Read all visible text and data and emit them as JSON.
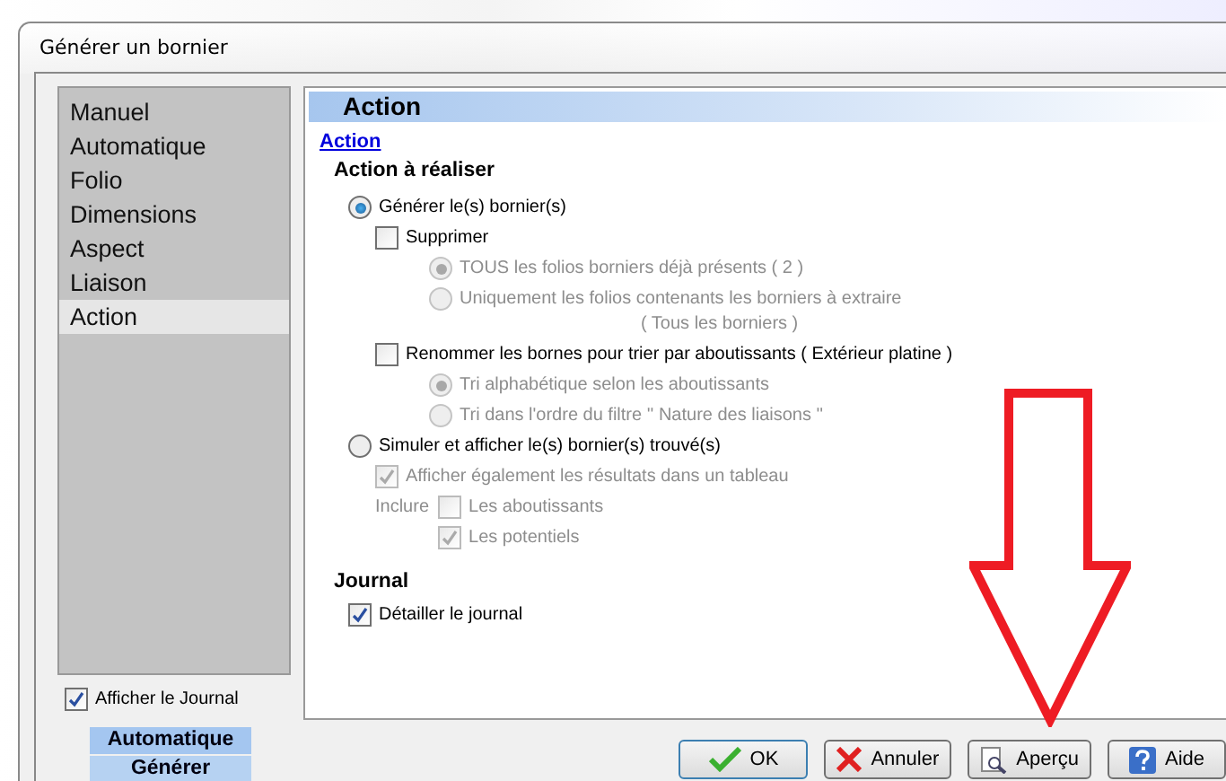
{
  "window": {
    "title": "Générer un bornier"
  },
  "sidebar": {
    "items": [
      {
        "label": "Manuel",
        "selected": false
      },
      {
        "label": "Automatique",
        "selected": false
      },
      {
        "label": "Folio",
        "selected": false
      },
      {
        "label": "Dimensions",
        "selected": false
      },
      {
        "label": "Aspect",
        "selected": false
      },
      {
        "label": "Liaison",
        "selected": false
      },
      {
        "label": "Action",
        "selected": true
      }
    ],
    "show_log": {
      "label": "Afficher le Journal",
      "checked": true
    }
  },
  "panel": {
    "header": "Action",
    "link": "Action",
    "section_title": "Action à réaliser",
    "options": [
      {
        "kind": "radio",
        "label": "Générer le(s) bornier(s)",
        "selected": true,
        "disabled": false,
        "children": [
          {
            "kind": "checkbox",
            "label": "Supprimer",
            "checked": false,
            "disabled": false,
            "children": [
              {
                "kind": "radio",
                "label": "TOUS les folios borniers déjà présents ( 2 )",
                "selected": true,
                "disabled": true
              },
              {
                "kind": "radio",
                "label": "Uniquement les folios contenants les borniers à extraire",
                "note": "( Tous les borniers )",
                "selected": false,
                "disabled": true
              }
            ]
          },
          {
            "kind": "checkbox",
            "label": "Renommer les bornes pour trier par aboutissants ( Extérieur platine )",
            "checked": false,
            "disabled": false,
            "children": [
              {
                "kind": "radio",
                "label": "Tri alphabétique selon les aboutissants",
                "selected": true,
                "disabled": true
              },
              {
                "kind": "radio",
                "label": "Tri dans l'ordre du filtre '' Nature des liaisons ''",
                "selected": false,
                "disabled": true
              }
            ]
          }
        ]
      },
      {
        "kind": "radio",
        "label": "Simuler et afficher le(s) bornier(s) trouvé(s)",
        "selected": false,
        "disabled": false,
        "children": [
          {
            "kind": "checkbox",
            "label": "Afficher également les résultats dans un tableau",
            "checked": true,
            "disabled": true
          },
          {
            "kind": "group",
            "label": "Inclure",
            "children": [
              {
                "kind": "checkbox",
                "label": "Les aboutissants",
                "checked": false,
                "disabled": true
              },
              {
                "kind": "checkbox",
                "label": "Les potentiels",
                "checked": true,
                "disabled": true
              }
            ]
          }
        ]
      }
    ],
    "journal_title": "Journal",
    "journal_detail": {
      "label": "Détailler le journal",
      "checked": true
    }
  },
  "bottom_tabs": [
    {
      "label": "Automatique",
      "selected": true
    },
    {
      "label": "Générer",
      "selected": false
    }
  ],
  "buttons": [
    {
      "kind": "ok",
      "label": "OK"
    },
    {
      "kind": "cancel",
      "label": "Annuler"
    },
    {
      "kind": "preview",
      "label": "Aperçu"
    },
    {
      "kind": "help",
      "label": "Aide"
    }
  ]
}
